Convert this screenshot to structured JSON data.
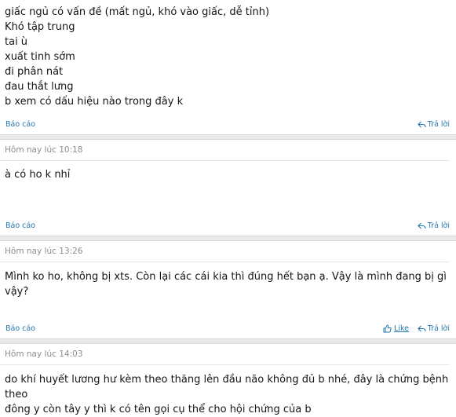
{
  "posts": [
    {
      "timestamp": "",
      "lines": [
        "giấc ngủ có vấn đề (mất ngủ, khó vào giấc, dễ tỉnh)",
        "Khó tập trung",
        "tai ù",
        "xuất tinh sớm",
        "đi phân nát",
        "đau thắt lưng",
        "b xem có dấu hiệu nào trong đây k"
      ],
      "report_label": "Báo cáo",
      "reply_label": "Trả lời"
    },
    {
      "timestamp": "Hôm nay lúc 10:18",
      "lines": [
        "à có ho k nhỉ"
      ],
      "report_label": "Báo cáo",
      "reply_label": "Trả lời"
    },
    {
      "timestamp": "Hôm nay lúc 13:26",
      "lines": [
        "Mình ko ho, không bị xts. Còn lại các cái kia thì đúng hết bạn ạ. Vậy là mình đang bị gì vậy?"
      ],
      "report_label": "Báo cáo",
      "like_label": "Like",
      "reply_label": "Trả lời"
    },
    {
      "timestamp": "Hôm nay lúc 14:03",
      "lines": [
        "do khí huyết lương hư kèm theo thăng lên đầu não không đủ b nhé, đây là chứng bệnh theo",
        "đông y còn tây y thì k có tên gọi cụ thể cho hội chứng của b"
      ]
    }
  ],
  "icons": {
    "reply": "reply-arrow-icon",
    "like": "thumbs-up-icon"
  },
  "colors": {
    "link": "#2577b1",
    "meta": "#8c8c8c",
    "separator": "#e9eaec"
  }
}
